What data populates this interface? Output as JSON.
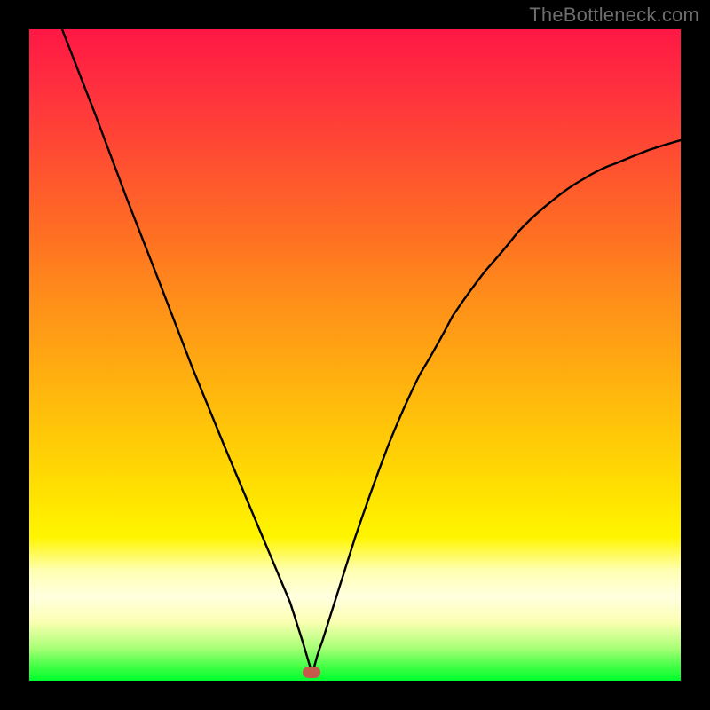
{
  "watermark": {
    "text": "TheBottleneck.com"
  },
  "chart_data": {
    "type": "line",
    "title": "",
    "xlabel": "",
    "ylabel": "",
    "xlim": [
      0,
      100
    ],
    "ylim": [
      0,
      100
    ],
    "grid": false,
    "legend": false,
    "series": [
      {
        "name": "curve",
        "x": [
          5,
          10,
          15,
          20,
          25,
          30,
          35,
          40,
          42,
          43.5,
          45,
          50,
          55,
          60,
          65,
          70,
          75,
          80,
          85,
          90,
          95,
          100
        ],
        "y": [
          100,
          87,
          74,
          61,
          48,
          36,
          24,
          12,
          6,
          1,
          6,
          22,
          36,
          47,
          56,
          63,
          69,
          73.5,
          77,
          79.5,
          81.5,
          83
        ]
      }
    ],
    "marker": {
      "x": 43.5,
      "y": 1
    },
    "background_gradient": {
      "stops": [
        {
          "pos": 0,
          "color": "#ff1744"
        },
        {
          "pos": 50,
          "color": "#ffb300"
        },
        {
          "pos": 80,
          "color": "#ffff66"
        },
        {
          "pos": 100,
          "color": "#00ff2e"
        }
      ]
    }
  }
}
